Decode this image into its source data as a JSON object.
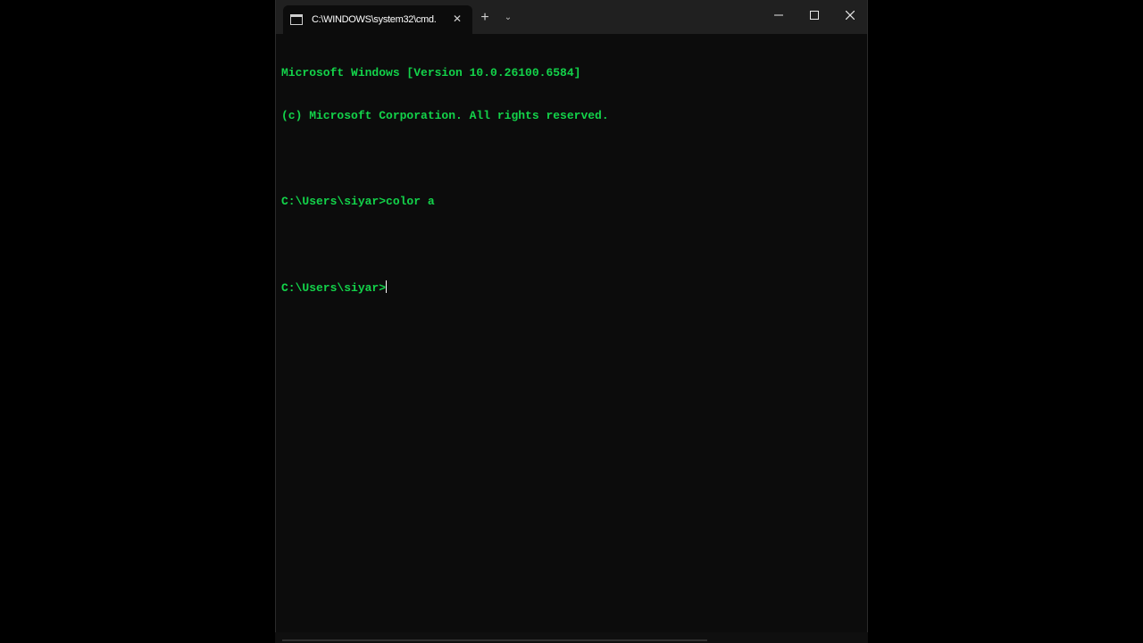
{
  "window": {
    "tab_title": "C:\\WINDOWS\\system32\\cmd.",
    "tab_close_glyph": "✕",
    "new_tab_glyph": "+",
    "dropdown_glyph": "⌄"
  },
  "terminal": {
    "lines": [
      "Microsoft Windows [Version 10.0.26100.6584]",
      "(c) Microsoft Corporation. All rights reserved.",
      "",
      "C:\\Users\\siyar>color a",
      "",
      "C:\\Users\\siyar>"
    ],
    "text_color": "#13d34a",
    "background_color": "#0c0c0c"
  }
}
